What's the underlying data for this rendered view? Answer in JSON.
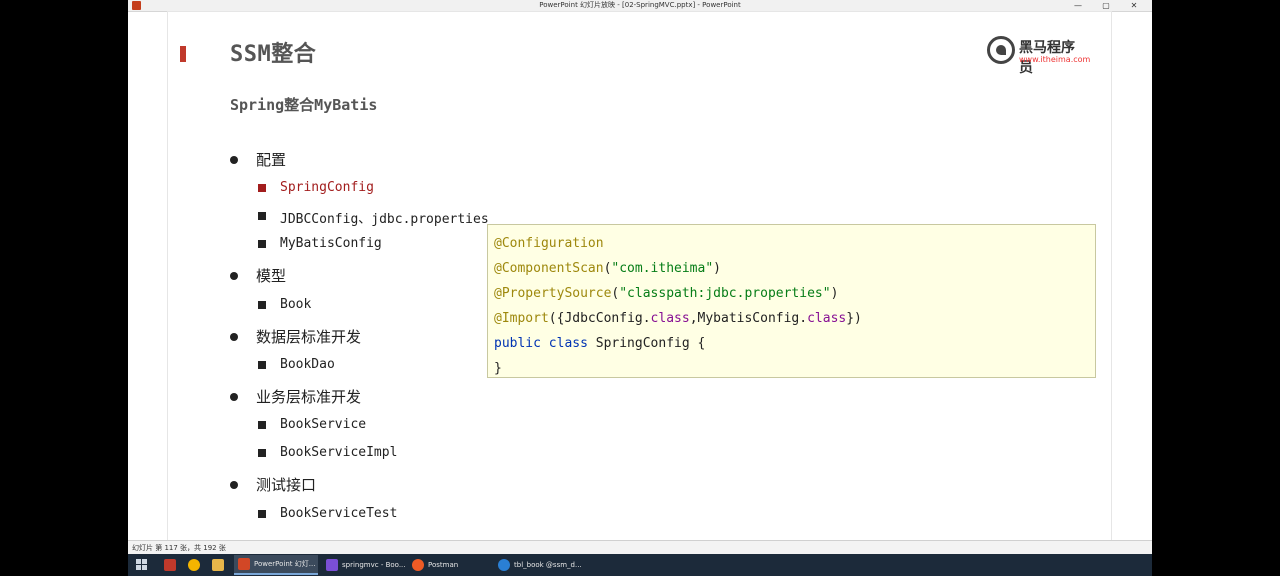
{
  "window": {
    "title": "PowerPoint 幻灯片放映 - [02-SpringMVC.pptx] - PowerPoint",
    "min": "—",
    "max": "▢",
    "close": "✕"
  },
  "slide": {
    "title": "SSM整合",
    "subtitle": "Spring整合MyBatis",
    "logo": {
      "name": "黑马程序员",
      "url": "www.itheima.com"
    },
    "sections": [
      {
        "label": "配置",
        "items": [
          "SpringConfig",
          "JDBCConfig、jdbc.properties",
          "MyBatisConfig"
        ]
      },
      {
        "label": "模型",
        "items": [
          "Book"
        ]
      },
      {
        "label": "数据层标准开发",
        "items": [
          "BookDao"
        ]
      },
      {
        "label": "业务层标准开发",
        "items": [
          "BookService",
          "BookServiceImpl"
        ]
      },
      {
        "label": "测试接口",
        "items": [
          "BookServiceTest"
        ]
      }
    ],
    "code": {
      "l1": "@Configuration",
      "l2_ann": "@ComponentScan",
      "l2_open": "(",
      "l2_str": "\"com.itheima\"",
      "l2_close": ")",
      "l3_ann": "@PropertySource",
      "l3_open": "(",
      "l3_str": "\"classpath:jdbc.properties\"",
      "l3_close": ")",
      "l4_ann": "@Import",
      "l4_a": "({JdbcConfig.",
      "l4_c1": "class",
      "l4_b": ",MybatisConfig.",
      "l4_c2": "class",
      "l4_end": "})",
      "l5_kw": "public class",
      "l5_rest": " SpringConfig {",
      "l6": "}"
    }
  },
  "statusbar": {
    "text": "幻灯片 第 117 张，共 192 张"
  },
  "taskbar": {
    "items": [
      {
        "label": "PowerPoint 幻灯..."
      },
      {
        "label": "springmvc - Boo..."
      },
      {
        "label": "Postman"
      },
      {
        "label": "tbl_book @ssm_d..."
      }
    ]
  },
  "colors": {
    "accent": "#c0392b",
    "bullet_red": "#a21d1d",
    "code_bg": "#ffffe4"
  }
}
